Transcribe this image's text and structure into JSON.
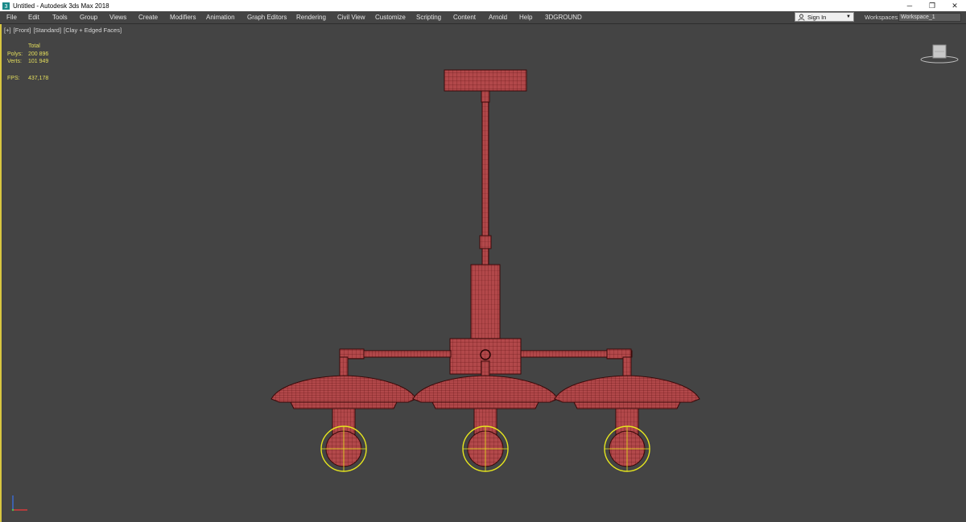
{
  "window": {
    "title": "Untitled - Autodesk 3ds Max 2018",
    "app_icon": "3ds-max-icon",
    "controls": {
      "minimize": "─",
      "restore": "❐",
      "close": "✕"
    }
  },
  "menu": {
    "items": [
      "File",
      "Edit",
      "Tools",
      "Group",
      "Views",
      "Create",
      "Modifiers",
      "Animation",
      "Graph Editors",
      "Rendering",
      "Civil View",
      "Customize",
      "Scripting",
      "Content",
      "Arnold",
      "Help",
      "3DGROUND"
    ]
  },
  "account": {
    "sign_in_label": "Sign In",
    "icon": "user-icon"
  },
  "workspaces": {
    "label": "Workspaces:",
    "value": "Workspace_1"
  },
  "viewport": {
    "labels": [
      "[+]",
      "[Front]",
      "[Standard]",
      "[Clay + Edged Faces]"
    ],
    "stats": {
      "header": "Total",
      "polys_label": "Polys:",
      "polys_value": "200 896",
      "verts_label": "Verts:",
      "verts_value": "101 949",
      "fps_label": "FPS:",
      "fps_value": "437,178"
    },
    "viewcube_icon": "viewcube-icon",
    "axis_icon": "axis-tripod-icon",
    "model": "chandelier-model",
    "colors": {
      "background": "#444444",
      "mesh_fill": "#b2484a",
      "mesh_wire": "#5a1010",
      "selection": "#e6e61e",
      "stats_text": "#e5df5c"
    }
  }
}
